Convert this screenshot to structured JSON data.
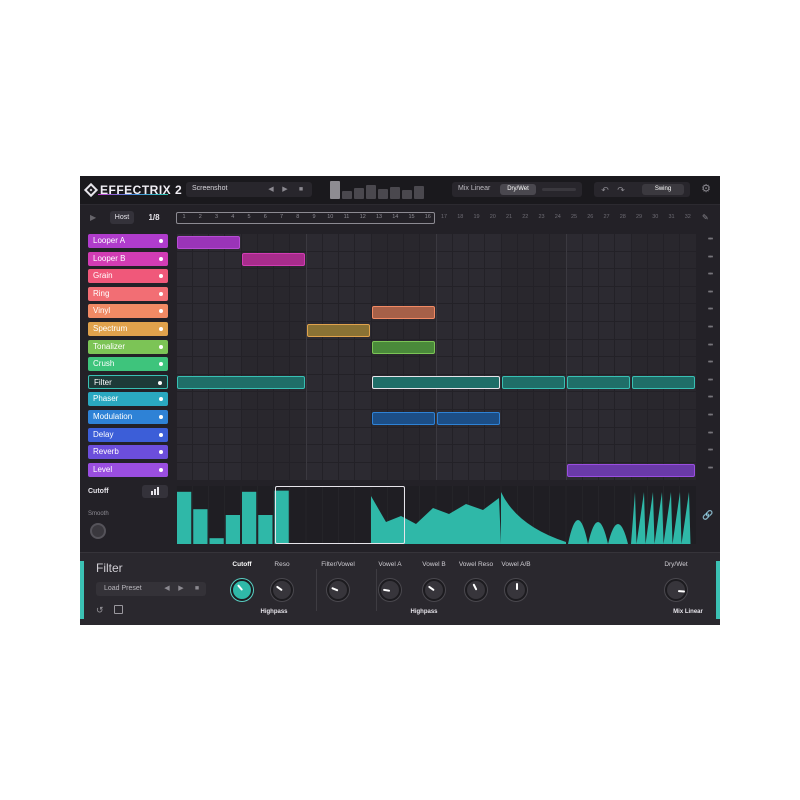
{
  "app": {
    "logo": "EFFECTRIX 2"
  },
  "header": {
    "preset_name": "Screenshot",
    "mix_mode": "Mix Linear",
    "drywet_label": "Dry/Wet",
    "swing_label": "Swing"
  },
  "sequencer": {
    "host_label": "Host",
    "rate_label": "1/8",
    "steps": [
      "1",
      "2",
      "3",
      "4",
      "5",
      "6",
      "7",
      "8",
      "9",
      "10",
      "11",
      "12",
      "13",
      "14",
      "15",
      "16",
      "17",
      "18",
      "19",
      "20",
      "21",
      "22",
      "23",
      "24",
      "25",
      "26",
      "27",
      "28",
      "29",
      "30",
      "31",
      "32"
    ]
  },
  "effects": [
    {
      "name": "Looper A",
      "color": "#b03ccc"
    },
    {
      "name": "Looper B",
      "color": "#d23cb4"
    },
    {
      "name": "Grain",
      "color": "#f0587a"
    },
    {
      "name": "Ring",
      "color": "#f26e74"
    },
    {
      "name": "Vinyl",
      "color": "#f28a64"
    },
    {
      "name": "Spectrum",
      "color": "#e0a24c"
    },
    {
      "name": "Tonalizer",
      "color": "#7cc456"
    },
    {
      "name": "Crush",
      "color": "#3ec47c"
    },
    {
      "name": "Filter",
      "color": "#38c0b4"
    },
    {
      "name": "Phaser",
      "color": "#2aa8c0"
    },
    {
      "name": "Modulation",
      "color": "#2e82d6"
    },
    {
      "name": "Delay",
      "color": "#3c5ed8"
    },
    {
      "name": "Reverb",
      "color": "#6c4edc"
    },
    {
      "name": "Level",
      "color": "#9a4ee0"
    }
  ],
  "clips": [
    {
      "row": 0,
      "start": 1,
      "end": 4,
      "color": "#9a34b8",
      "border": "#b84cd4"
    },
    {
      "row": 1,
      "start": 5,
      "end": 8,
      "color": "#a82c8c",
      "border": "#d23cb4"
    },
    {
      "row": 4,
      "start": 13,
      "end": 16,
      "color": "#a66048",
      "border": "#f28a64"
    },
    {
      "row": 5,
      "start": 9,
      "end": 12,
      "color": "#8a7234",
      "border": "#e0a24c"
    },
    {
      "row": 6,
      "start": 13,
      "end": 16,
      "color": "#4a8a3a",
      "border": "#7cc456"
    },
    {
      "row": 8,
      "start": 1,
      "end": 8,
      "color": "#1f6e68",
      "border": "#38c0b4"
    },
    {
      "row": 8,
      "start": 13,
      "end": 20,
      "color": "#1f6e68",
      "border": "#e6e4ea"
    },
    {
      "row": 8,
      "start": 21,
      "end": 24,
      "color": "#1f6e68",
      "border": "#38c0b4"
    },
    {
      "row": 8,
      "start": 25,
      "end": 28,
      "color": "#1f6e68",
      "border": "#38c0b4"
    },
    {
      "row": 8,
      "start": 29,
      "end": 32,
      "color": "#1f6e68",
      "border": "#38c0b4"
    },
    {
      "row": 10,
      "start": 13,
      "end": 16,
      "color": "#1c4e86",
      "border": "#2e82d6"
    },
    {
      "row": 10,
      "start": 17,
      "end": 20,
      "color": "#1c4e86",
      "border": "#2e82d6"
    },
    {
      "row": 13,
      "start": 25,
      "end": 32,
      "color": "#6a3aa8",
      "border": "#9a4ee0"
    }
  ],
  "lane": {
    "param_label": "Cutoff",
    "smooth_label": "Smooth",
    "bars": [
      0.9,
      0.6,
      0.1,
      0.5,
      0.9,
      0.5,
      0.92,
      0
    ]
  },
  "panel": {
    "title": "Filter",
    "load_preset": "Load Preset",
    "knobs": [
      {
        "label": "Cutoff",
        "value": 0.35,
        "teal": true,
        "bold": true
      },
      {
        "label": "Reso",
        "value": 0.3
      },
      {
        "label": "Filter/Vowel",
        "value": 0.25
      },
      {
        "label": "Vowel A",
        "value": 0.2
      },
      {
        "label": "Vowel B",
        "value": 0.3
      },
      {
        "label": "Vowel Reso",
        "value": 0.4
      },
      {
        "label": "Vowel A/B",
        "value": 0.5
      },
      {
        "label": "Dry/Wet",
        "value": 0.85
      }
    ],
    "highpass1": "Highpass",
    "highpass2": "Highpass",
    "mix_linear": "Mix Linear"
  },
  "colors": {
    "accent": "#38c0b4",
    "background": "#232127"
  }
}
